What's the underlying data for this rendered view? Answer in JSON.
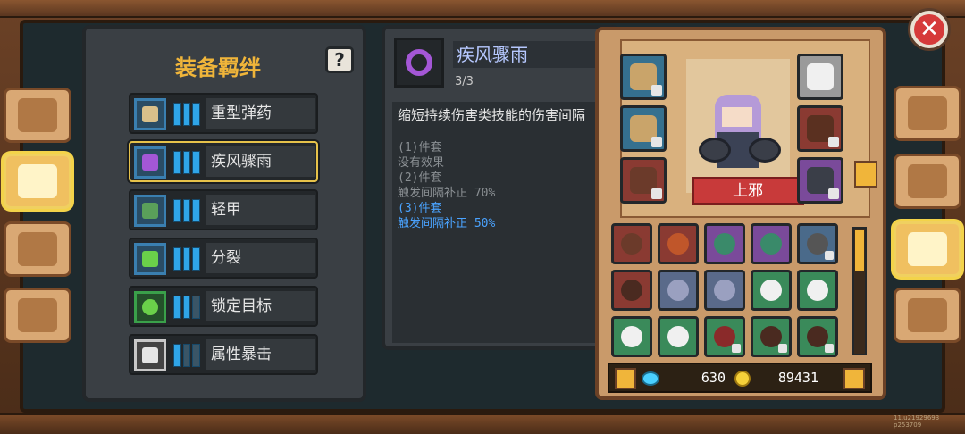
{
  "bonds": {
    "title": "装备羁绊",
    "help_label": "?",
    "items": [
      {
        "label": "重型弹药",
        "icon": "ammo-icon",
        "color": "#d9c08a",
        "level": 3
      },
      {
        "label": "疾风骤雨",
        "icon": "whirlwind-icon",
        "color": "#a457d6",
        "level": 3,
        "selected": true
      },
      {
        "label": "轻甲",
        "icon": "light-armor-icon",
        "color": "#5aa05a",
        "level": 3
      },
      {
        "label": "分裂",
        "icon": "split-icon",
        "color": "#6ad04a",
        "level": 3
      },
      {
        "label": "锁定目标",
        "icon": "target-icon",
        "color": "#6ad04a",
        "level": 2
      },
      {
        "label": "属性暴击",
        "icon": "crit-icon",
        "color": "#e6e6e6",
        "level": 1
      }
    ]
  },
  "detail": {
    "name": "疾风骤雨",
    "count": "3/3",
    "description": "缩短持续伤害类技能的伤害间隔",
    "lines": [
      {
        "text": "(1)件套",
        "active": false
      },
      {
        "text": "没有效果",
        "active": false
      },
      {
        "text": "(2)件套",
        "active": false
      },
      {
        "text": "触发间隔补正 70%",
        "active": false
      },
      {
        "text": "(3)件套",
        "active": true
      },
      {
        "text": "触发间隔补正 50%",
        "active": true
      }
    ]
  },
  "character": {
    "name": "上邪"
  },
  "currency": {
    "gems": "630",
    "coins": "89431"
  },
  "version": "11.u21929693 p253709",
  "colors": {
    "accent": "#f0b53a",
    "active_text": "#4aa3ff",
    "close": "#d63a3a"
  }
}
